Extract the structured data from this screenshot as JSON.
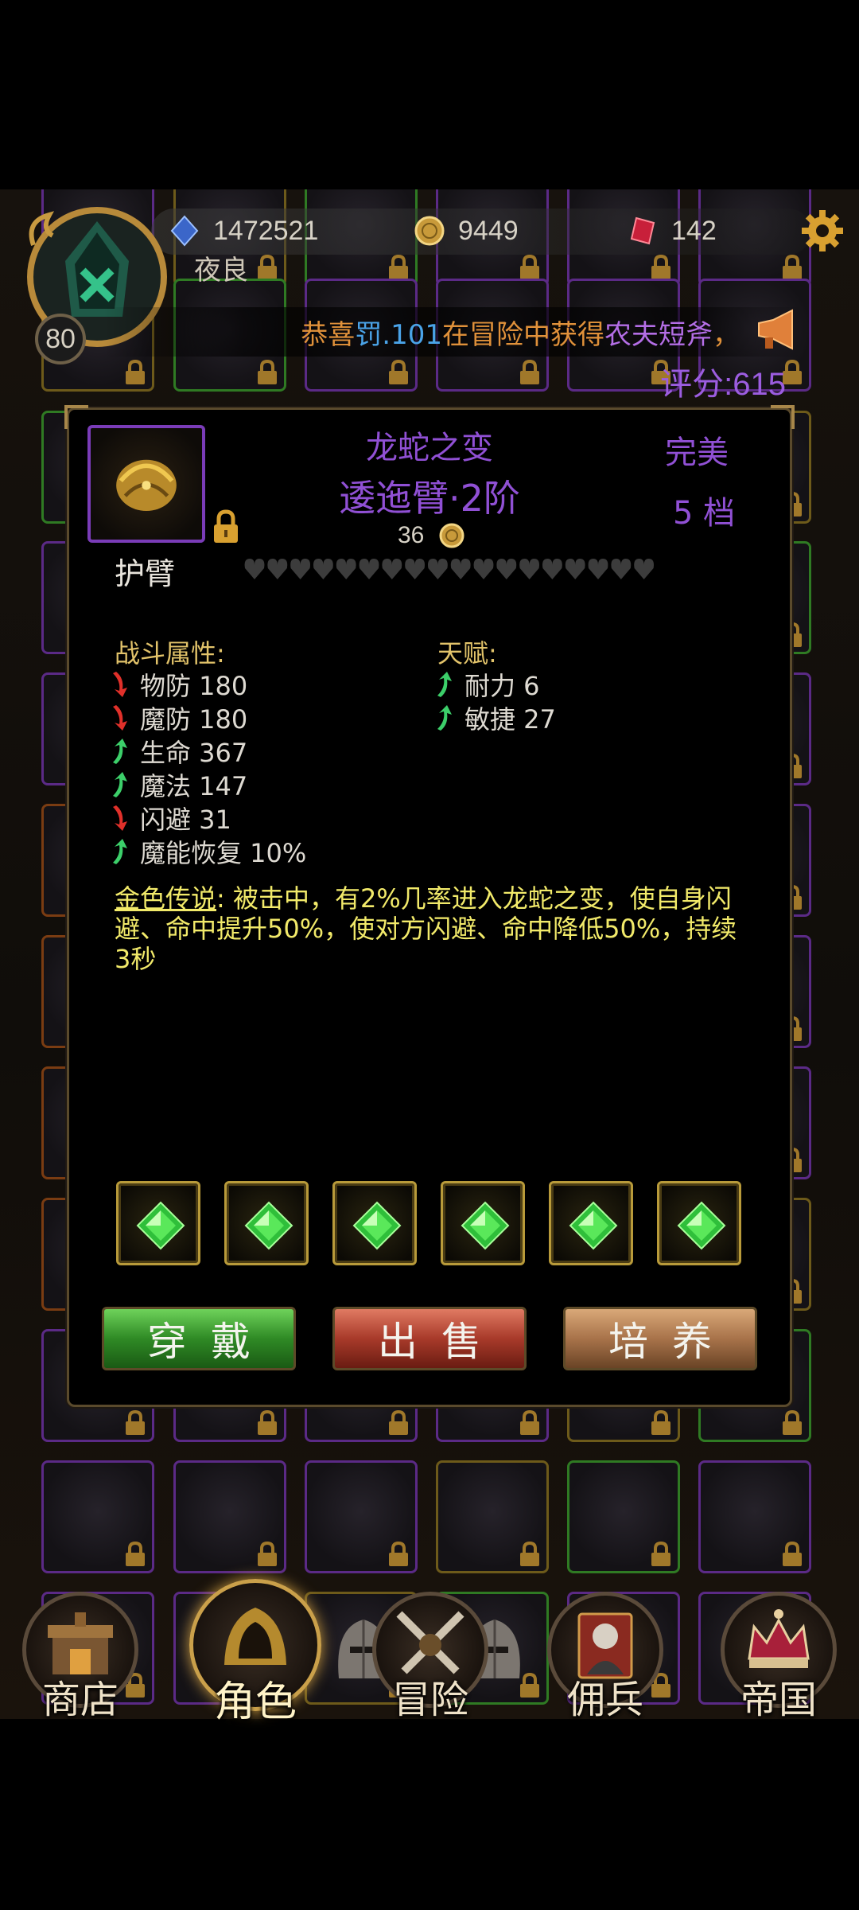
{
  "hud": {
    "diamonds": "1472521",
    "gold": "9449",
    "gems": "142",
    "player_name": "夜良",
    "level": "80",
    "announcement": {
      "prefix": "恭喜",
      "player": "罚.101",
      "middle": "在冒险中获得",
      "item": "农夫短斧",
      "suffix": "，"
    },
    "score": "评分:615"
  },
  "item": {
    "set_name": "龙蛇之变",
    "name": "逶迤臂·2阶",
    "price": "36",
    "category": "护臂",
    "quality": "完美",
    "grade": "5 档",
    "hearts_total": 18
  },
  "combat": {
    "title": "战斗属性:",
    "stats": [
      {
        "label": "物防 180",
        "dir": "down"
      },
      {
        "label": "魔防 180",
        "dir": "down"
      },
      {
        "label": "生命 367",
        "dir": "up"
      },
      {
        "label": "魔法 147",
        "dir": "up"
      },
      {
        "label": "闪避 31",
        "dir": "down"
      },
      {
        "label": "魔能恢复 10%",
        "dir": "up"
      }
    ]
  },
  "talent": {
    "title": "天赋:",
    "stats": [
      {
        "label": "耐力 6",
        "dir": "up"
      },
      {
        "label": "敏捷 27",
        "dir": "up"
      }
    ]
  },
  "legend": {
    "tag": "金色传说",
    "text": ": 被击中，有2%几率进入龙蛇之变，使自身闪避、命中提升50%，使对方闪避、命中降低50%，持续3秒"
  },
  "gem_count": 6,
  "buttons": {
    "wear": "穿戴",
    "sell": "出售",
    "train": "培养"
  },
  "nav": [
    {
      "label": "商店",
      "icon": "shop-icon"
    },
    {
      "label": "角色",
      "icon": "hood-icon"
    },
    {
      "label": "冒险",
      "icon": "crossed-swords-icon"
    },
    {
      "label": "佣兵",
      "icon": "mercenary-card-icon"
    },
    {
      "label": "帝国",
      "icon": "crown-icon"
    }
  ],
  "colors": {
    "purple_text": "#9050d4",
    "gold_text": "#e2c36a",
    "legend_text": "#f2ea6a",
    "up_arrow": "#3ccf6a",
    "down_arrow": "#e0302a"
  }
}
